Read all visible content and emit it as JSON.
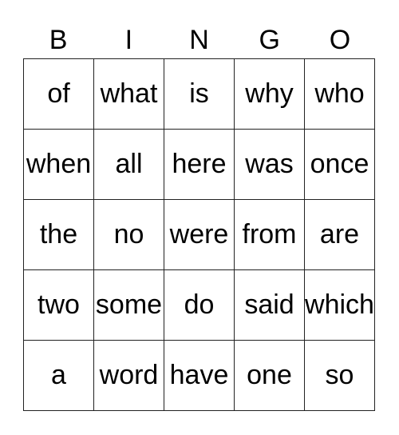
{
  "header": [
    "B",
    "I",
    "N",
    "G",
    "O"
  ],
  "grid": [
    [
      "of",
      "what",
      "is",
      "why",
      "who"
    ],
    [
      "when",
      "all",
      "here",
      "was",
      "once"
    ],
    [
      "the",
      "no",
      "were",
      "from",
      "are"
    ],
    [
      "two",
      "some",
      "do",
      "said",
      "which"
    ],
    [
      "a",
      "word",
      "have",
      "one",
      "so"
    ]
  ]
}
